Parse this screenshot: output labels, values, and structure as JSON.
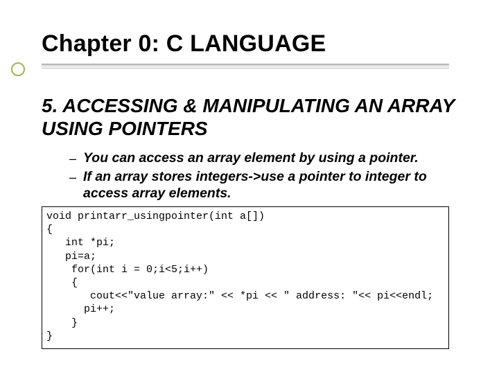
{
  "title": "Chapter 0: C LANGUAGE",
  "section": "5. ACCESSING & MANIPULATING AN ARRAY USING POINTERS",
  "bullets": [
    "You can access an array element by using a pointer.",
    "If an array stores integers->use a pointer to integer to access array elements."
  ],
  "code": "void printarr_usingpointer(int a[])\n{\n   int *pi;\n   pi=a;\n    for(int i = 0;i<5;i++)\n    {\n       cout<<\"value array:\" << *pi << \" address: \"<< pi<<endl;\n      pi++;\n    }\n}"
}
